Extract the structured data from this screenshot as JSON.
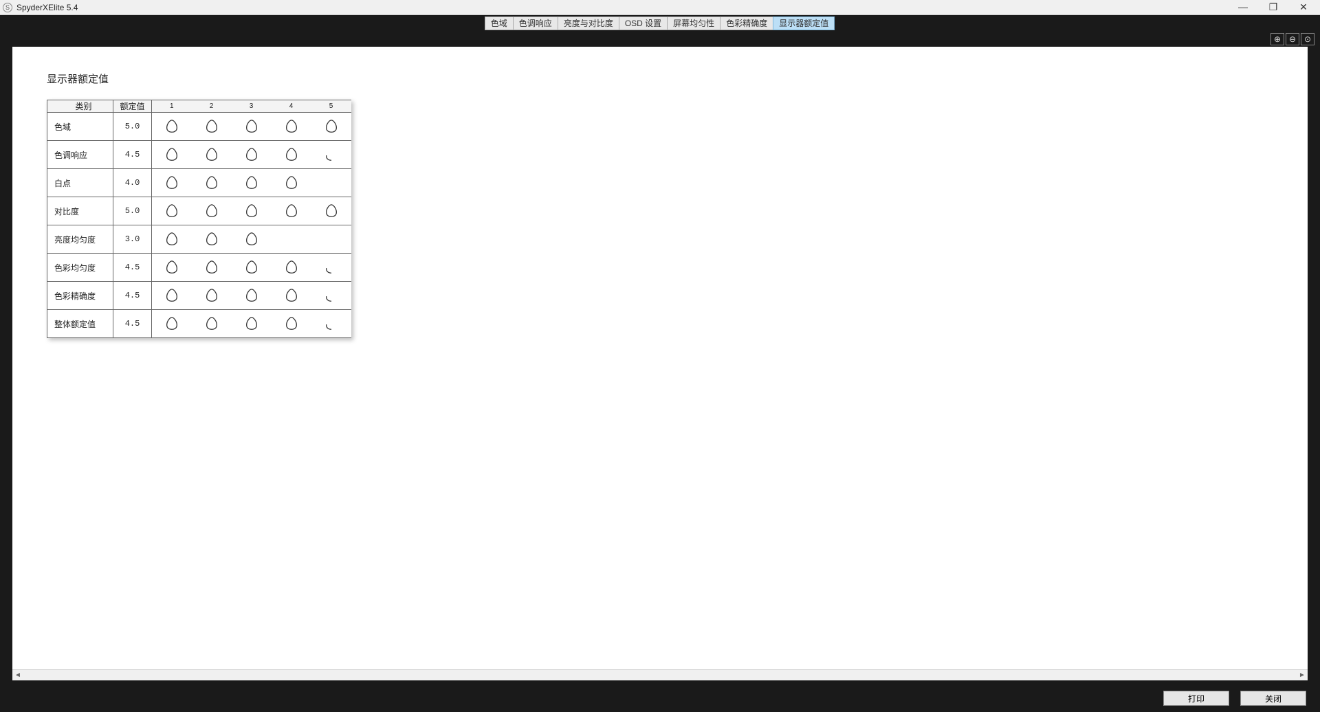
{
  "app": {
    "icon_char": "S",
    "title": "SpyderXElite 5.4"
  },
  "window_controls": {
    "minimize": "—",
    "maximize": "❐",
    "close": "✕"
  },
  "tabs": [
    {
      "label": "色域",
      "active": false
    },
    {
      "label": "色调响应",
      "active": false
    },
    {
      "label": "亮度与对比度",
      "active": false
    },
    {
      "label": "OSD 设置",
      "active": false
    },
    {
      "label": "屏幕均匀性",
      "active": false
    },
    {
      "label": "色彩精确度",
      "active": false
    },
    {
      "label": "显示器额定值",
      "active": true
    }
  ],
  "zoom": {
    "zoom_in": "⊕",
    "zoom_out": "⊖",
    "zoom_fit": "⊙"
  },
  "page": {
    "title": "显示器额定值"
  },
  "table": {
    "headers": {
      "category": "类别",
      "value": "额定值",
      "scale": [
        "1",
        "2",
        "3",
        "4",
        "5"
      ]
    },
    "rows": [
      {
        "category": "色域",
        "value": "5.0",
        "rating": 5.0
      },
      {
        "category": "色调响应",
        "value": "4.5",
        "rating": 4.5
      },
      {
        "category": "白点",
        "value": "4.0",
        "rating": 4.0
      },
      {
        "category": "对比度",
        "value": "5.0",
        "rating": 5.0
      },
      {
        "category": "亮度均匀度",
        "value": "3.0",
        "rating": 3.0
      },
      {
        "category": "色彩均匀度",
        "value": "4.5",
        "rating": 4.5
      },
      {
        "category": "色彩精确度",
        "value": "4.5",
        "rating": 4.5
      },
      {
        "category": "整体额定值",
        "value": "4.5",
        "rating": 4.5
      }
    ]
  },
  "footer": {
    "print": "打印",
    "close": "关闭"
  }
}
